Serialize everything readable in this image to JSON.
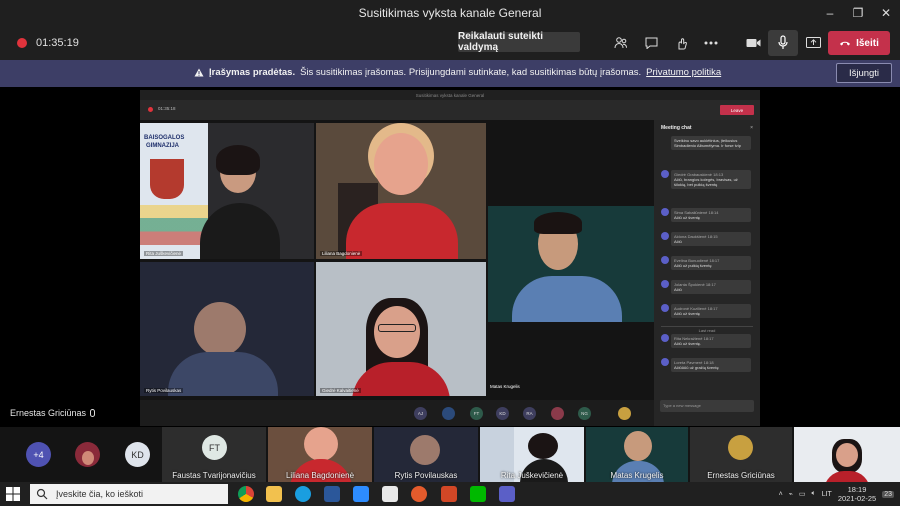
{
  "window": {
    "title": "Susitikimas vyksta kanale General",
    "controls": [
      "–",
      "❐",
      "✕"
    ]
  },
  "meeting": {
    "timer": "01:35:19",
    "request_control": "Reikalauti suteikti valdymą",
    "leave": "Išeiti"
  },
  "banner": {
    "bold": "Įrašymas pradėtas.",
    "text": "Šis susitikimas įrašomas. Prisijungdami sutinkate, kad susitikimas būtų įrašomas.",
    "link": "Privatumo politika",
    "button": "Išjungti"
  },
  "shared_screen": {
    "title": "Susitikimas vyksta kanale General",
    "timer": "01:35:18",
    "leave": "Leave",
    "tiles": [
      {
        "name": "Rita Juškevičienė"
      },
      {
        "name": "Liliana Bagdonienė"
      },
      {
        "name": "Matas Krugelis"
      },
      {
        "name": "Rytis Povilauskas"
      },
      {
        "name": "Giedrė Kalvaitienė"
      }
    ],
    "school_sign": [
      "BAISOGALOS",
      "GIMNAZIJA"
    ],
    "chat": {
      "header": "Meeting chat",
      "messages": [
        {
          "who": "",
          "text": "Sveikinu savo auklėtinius, įteikusius Simbadienio Albumėlyma. Ir forse tvip",
          "time": ""
        },
        {
          "who": "Giedrė Grabauskienė",
          "time": "18:13",
          "text": "Ačiū, brangios kolegės, bravisas, už šilokią, bet puikią šventę"
        },
        {
          "who": "Sima Sabaliūnienė",
          "time": "18:14",
          "text": "Ačiū už šventę"
        },
        {
          "who": "Aldona Daukšienė",
          "time": "18:15",
          "text": "Ačiū"
        },
        {
          "who": "Evelina Bunuolienė",
          "time": "18:17",
          "text": "Ačiū už puikią šventę"
        },
        {
          "who": "Jolanta Špokienė",
          "time": "18:17",
          "text": "Ačiū"
        },
        {
          "who": "Audronė Kuzilienė",
          "time": "18:17",
          "text": "Ačiū už šventę"
        },
        {
          "who": "Rita Nekražienė",
          "time": "18:17",
          "text": "Ačiū už šventę."
        },
        {
          "who": "Loreta Pavmerė",
          "time": "18:18",
          "text": "Ačiūūūū už gražią šventę"
        }
      ],
      "last_read": "Last read",
      "input_placeholder": "Type a new message"
    },
    "roster": [
      "AJ",
      "",
      "FT",
      "KD",
      "RA",
      "",
      "NG",
      ""
    ]
  },
  "stage_label": "Ernestas Griciūnas",
  "roster": {
    "overflow": "+4",
    "kd": "KD",
    "ft_initials": "FT",
    "tiles": [
      {
        "name": "Faustas Tvarijonavičius"
      },
      {
        "name": "Liliana Bagdonienė"
      },
      {
        "name": "Rytis Povilauskas"
      },
      {
        "name": "Rita Juškevičienė"
      },
      {
        "name": "Matas Krugelis"
      },
      {
        "name": "Ernestas Griciūnas"
      }
    ]
  },
  "taskbar": {
    "search_placeholder": "Įveskite čia, ko ieškoti",
    "language": "LIT",
    "time": "18:19",
    "date": "2021-02-25",
    "notifications": "23"
  },
  "colors": {
    "accent": "#5b5fc7",
    "leave": "#c4314b",
    "banner": "#3d3e66",
    "record": "#e0333c"
  }
}
